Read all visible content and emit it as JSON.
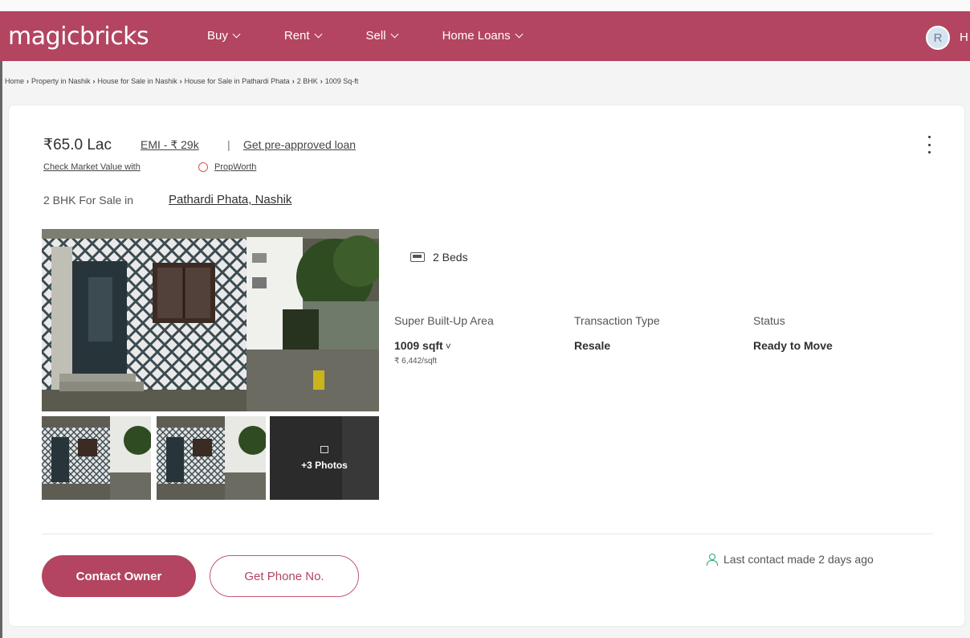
{
  "header": {
    "logo": "magicbricks",
    "nav": [
      {
        "label": "Buy"
      },
      {
        "label": "Rent"
      },
      {
        "label": "Sell"
      },
      {
        "label": "Home Loans"
      }
    ],
    "avatar_initial": "R",
    "avatar_tail": "H"
  },
  "breadcrumb": [
    "Home",
    "Property in Nashik",
    "House for Sale in Nashik",
    "House for Sale in Pathardi Phata",
    "2 BHK",
    "1009 Sq-ft"
  ],
  "listing": {
    "price": "₹65.0 Lac",
    "emi": "EMI - ₹ 29k",
    "separator": "|",
    "preapproved": "Get pre-approved loan",
    "market_value": "Check Market Value with",
    "propworth": "PropWorth",
    "bhk_prefix": "2 BHK For Sale in",
    "location": "Pathardi Phata, Nashik",
    "more_photos": "+3 Photos",
    "beds": "2 Beds",
    "details": [
      {
        "label": "Super Built-Up Area",
        "value": "1009 sqft",
        "sub": "₹ 6,442/sqft"
      },
      {
        "label": "Transaction Type",
        "value": "Resale"
      },
      {
        "label": "Status",
        "value": "Ready to Move"
      }
    ],
    "contact_btn": "Contact Owner",
    "phone_btn": "Get Phone No.",
    "last_contact": "Last contact made 2 days ago"
  },
  "colors": {
    "brand": "#b34560",
    "accent_green": "#28a86b"
  }
}
